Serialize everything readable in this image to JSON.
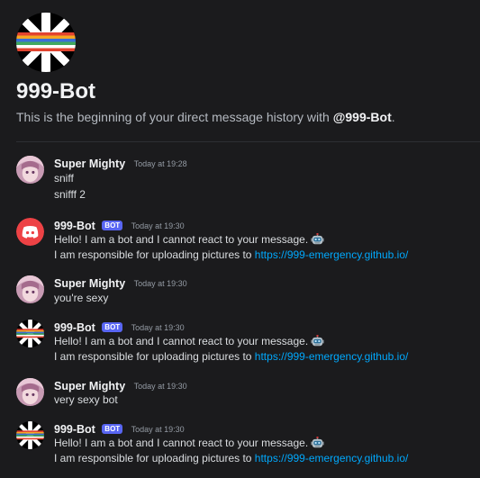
{
  "channel": {
    "title": "999-Bot",
    "intro_prefix": "This is the beginning of your direct message history with ",
    "intro_name": "@999-Bot",
    "intro_suffix": "."
  },
  "labels": {
    "bot_tag": "BOT"
  },
  "colors": {
    "background": "#1b1b1d",
    "link": "#00a8fc",
    "bot_tag": "#5865f2",
    "discord_red": "#ed4245"
  },
  "messages": [
    {
      "author": "Super Mighty",
      "avatar": "anime-avatar-icon",
      "bot": false,
      "time": "Today at 19:28",
      "lines": [
        "sniff",
        "snifff 2"
      ]
    },
    {
      "author": "999-Bot",
      "avatar": "discord-default-avatar-icon",
      "bot": true,
      "time": "Today at 19:30",
      "line1": "Hello! I am a bot and I cannot react to your message.",
      "line2_prefix": "I am responsible for uploading pictures to ",
      "link": "https://999-emergency.github.io/"
    },
    {
      "author": "Super Mighty",
      "avatar": "anime-avatar-icon",
      "bot": false,
      "time": "Today at 19:30",
      "lines": [
        "you're sexy"
      ]
    },
    {
      "author": "999-Bot",
      "avatar": "union-jack-avatar-icon",
      "bot": true,
      "time": "Today at 19:30",
      "line1": "Hello! I am a bot and I cannot react to your message.",
      "line2_prefix": "I am responsible for uploading pictures to ",
      "link": "https://999-emergency.github.io/"
    },
    {
      "author": "Super Mighty",
      "avatar": "anime-avatar-icon",
      "bot": false,
      "time": "Today at 19:30",
      "lines": [
        "very sexy bot"
      ]
    },
    {
      "author": "999-Bot",
      "avatar": "union-jack-avatar-icon",
      "bot": true,
      "time": "Today at 19:30",
      "line1": "Hello! I am a bot and I cannot react to your message.",
      "line2_prefix": "I am responsible for uploading pictures to ",
      "link": "https://999-emergency.github.io/"
    }
  ]
}
